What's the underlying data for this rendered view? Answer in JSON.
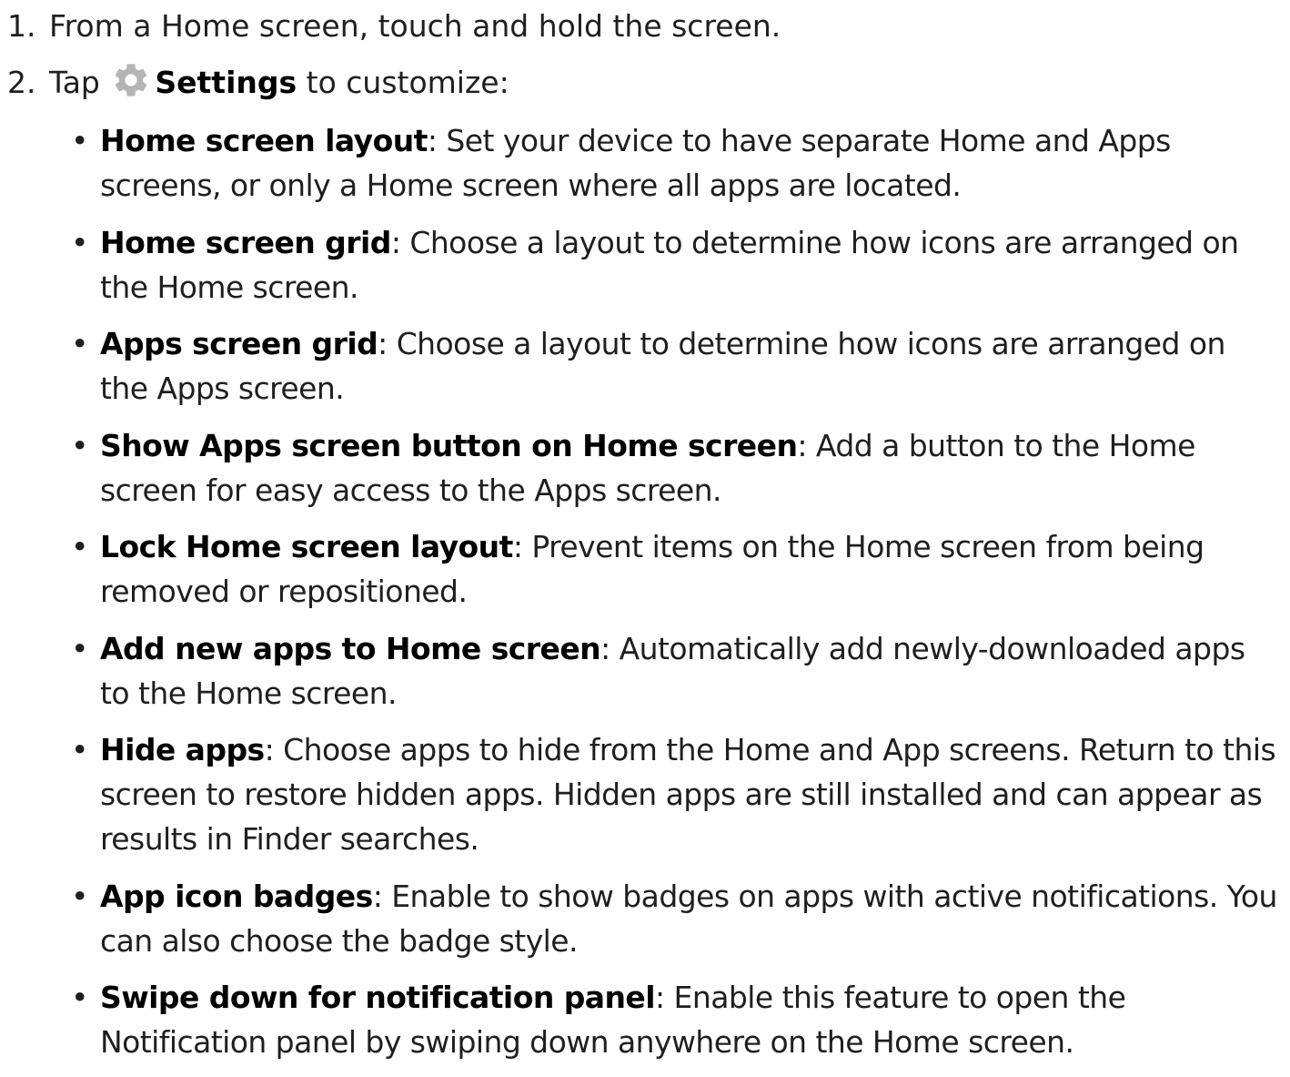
{
  "steps": [
    {
      "number": "1.",
      "text": "From a Home screen, touch and hold the screen."
    },
    {
      "number": "2.",
      "prefix": "Tap",
      "icon": "settings-gear-icon",
      "bold": "Settings",
      "suffix": "to customize:"
    }
  ],
  "options": [
    {
      "term": "Home screen layout",
      "sep": ":",
      "desc": " Set your device to have separate Home and Apps screens, or only a Home screen where all apps are located."
    },
    {
      "term": "Home screen grid",
      "sep": ":",
      "desc": " Choose a layout to determine how icons are arranged on the Home screen."
    },
    {
      "term": "Apps screen grid",
      "sep": ":",
      "desc": " Choose a layout to determine how icons are arranged on the Apps screen."
    },
    {
      "term": "Show Apps screen button on Home screen",
      "sep": ":",
      "desc": " Add a button to the Home screen for easy access to the Apps screen."
    },
    {
      "term": "Lock Home screen layout",
      "sep": ":",
      "desc": " Prevent items on the Home screen from being removed or repositioned."
    },
    {
      "term": "Add new apps to Home screen",
      "sep": ":",
      "desc": " Automatically add newly-downloaded apps to the Home screen."
    },
    {
      "term": "Hide apps",
      "sep": ":",
      "desc": " Choose apps to hide from the Home and App screens. Return to this screen to restore hidden apps. Hidden apps are still installed and can appear as results in Finder searches."
    },
    {
      "term": "App icon badges",
      "sep": ":",
      "desc": " Enable to show badges on apps with active notifications. You can also choose the badge style."
    },
    {
      "term": "Swipe down for notification panel",
      "sep": ":",
      "desc": " Enable this feature to open the Notification panel by swiping down anywhere on the Home screen."
    }
  ],
  "colors": {
    "text": "#1f1f1f",
    "gear_icon": "#b4b4b4"
  }
}
